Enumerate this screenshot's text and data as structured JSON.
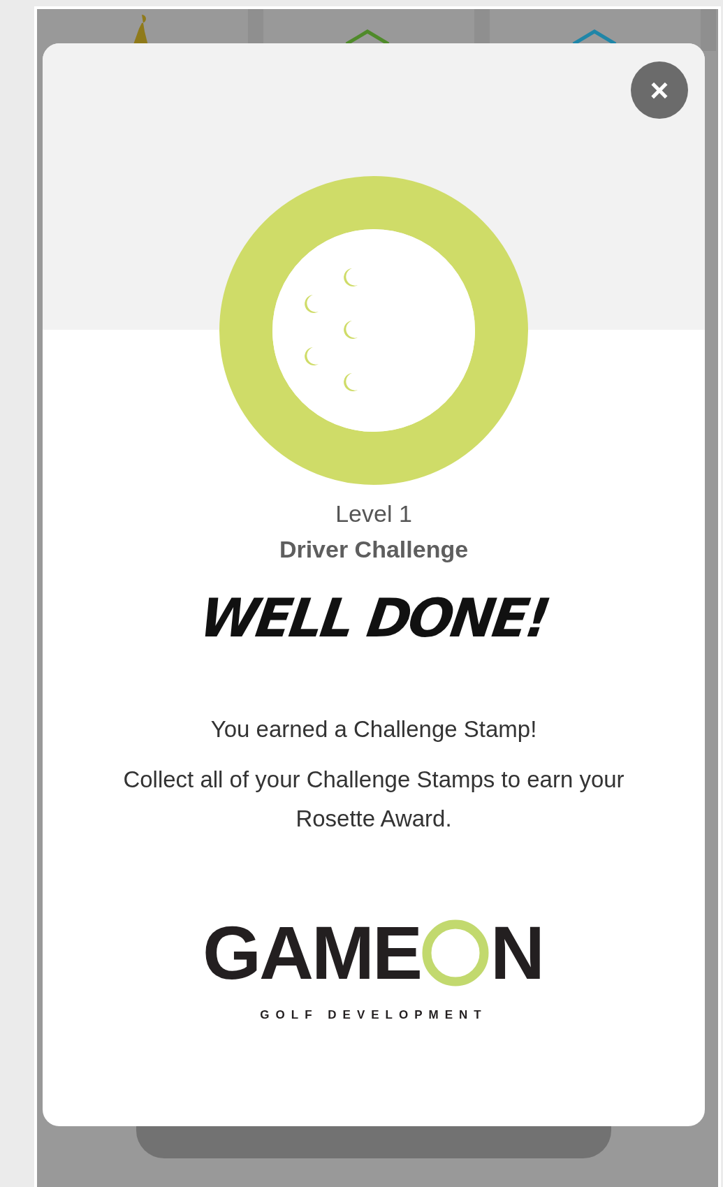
{
  "modal": {
    "level": "Level 1",
    "challenge": "Driver Challenge",
    "headline": "WELL DONE!",
    "message": "You earned a Challenge Stamp!",
    "details": "Collect all of your Challenge Stamps to earn your Rosette Award.",
    "close_label": "×"
  },
  "logo": {
    "wordmark_left": "GAME",
    "wordmark_right": "N",
    "tagline": "GOLF DEVELOPMENT"
  }
}
